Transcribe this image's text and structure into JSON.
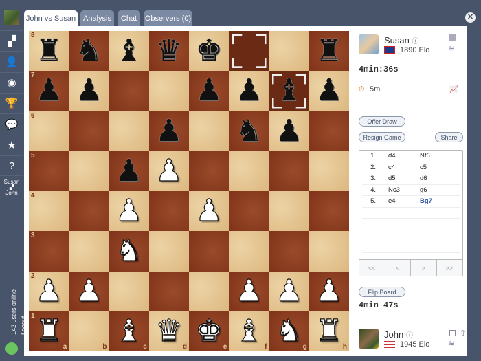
{
  "tabs": [
    {
      "label": "John vs Susan"
    },
    {
      "label": "Analysis"
    },
    {
      "label": "Chat"
    },
    {
      "label": "Observers (0)"
    }
  ],
  "sidebar": {
    "items": [
      {
        "icon": "checkered-flag-icon",
        "glyph": "▞"
      },
      {
        "icon": "person-icon",
        "glyph": "👤"
      },
      {
        "icon": "eye-icon",
        "glyph": "◉"
      },
      {
        "icon": "trophy-icon",
        "glyph": "🏆"
      },
      {
        "icon": "chat-icon",
        "glyph": "💬"
      },
      {
        "icon": "star-icon",
        "glyph": "★"
      },
      {
        "icon": "help-icon",
        "glyph": "?"
      }
    ],
    "game_top": "Susan",
    "game_bottom": "John",
    "online": "142 users online",
    "logout": "Logout"
  },
  "board": {
    "ranks": [
      "rnbqk..r",
      "pp..ppbp",
      "...p.np.",
      "..pP....",
      "..P.P...",
      "..N.....",
      "PP...PPP",
      "R.BQKBNR"
    ],
    "highlight": [
      "f8",
      "g7"
    ],
    "files": [
      "a",
      "b",
      "c",
      "d",
      "e",
      "f",
      "g",
      "h"
    ],
    "rank_labels": [
      "8",
      "7",
      "6",
      "5",
      "4",
      "3",
      "2",
      "1"
    ]
  },
  "opponent": {
    "name": "Susan",
    "elo": "1890 Elo",
    "clock": "4min:36s",
    "time_control": "5m"
  },
  "player": {
    "name": "John",
    "elo": "1945 Elo",
    "clock": "4min 47s"
  },
  "buttons": {
    "offer_draw": "Offer Draw",
    "resign": "Resign Game",
    "share": "Share",
    "flip": "Flip Board"
  },
  "moves": [
    {
      "n": "1.",
      "w": "d4",
      "b": "Nf6"
    },
    {
      "n": "2.",
      "w": "c4",
      "b": "c5"
    },
    {
      "n": "3.",
      "w": "d5",
      "b": "d6"
    },
    {
      "n": "4.",
      "w": "Nc3",
      "b": "g6"
    },
    {
      "n": "5.",
      "w": "e4",
      "b": "Bg7"
    }
  ],
  "nav": [
    "<<",
    "<",
    ">",
    ">>"
  ],
  "colors": {
    "accent": "#3a5cad",
    "online": "#6cc461"
  }
}
